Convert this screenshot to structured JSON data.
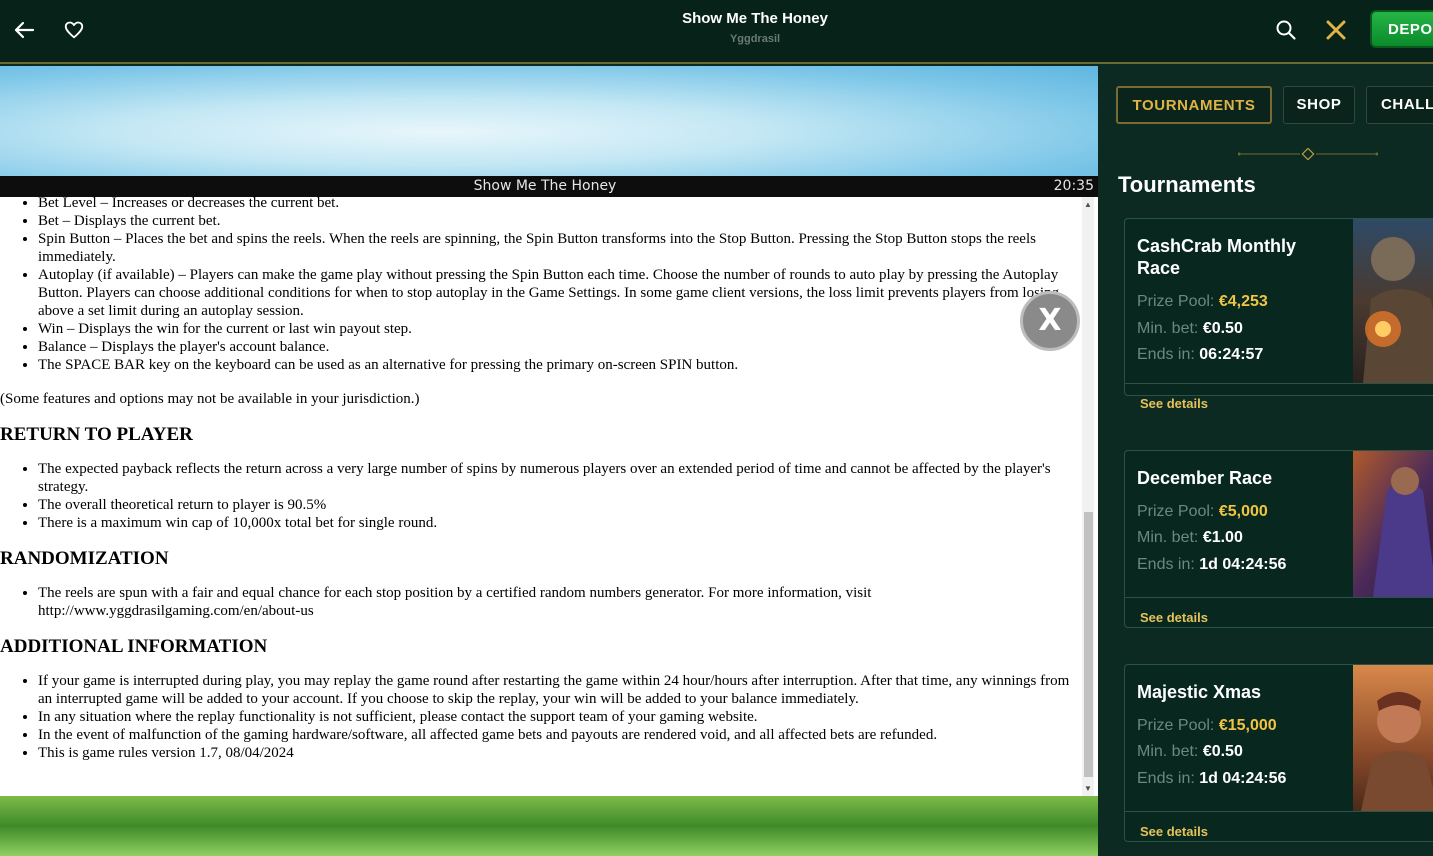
{
  "header": {
    "title": "Show Me The Honey",
    "subtitle": "Yggdrasil",
    "deposit_label": "DEPO"
  },
  "game": {
    "title": "Show Me The Honey",
    "time": "20:35",
    "close_label": "X"
  },
  "rules": {
    "list1": [
      "Bet Level – Increases or decreases the current bet.",
      "Bet – Displays the current bet.",
      "Spin Button – Places the bet and spins the reels. When the reels are spinning, the Spin Button transforms into the Stop Button. Pressing the Stop Button stops the reels immediately.",
      "Autoplay (if available) – Players can make the game play without pressing the Spin Button each time. Choose the number of rounds to auto play by pressing the Autoplay Button. Players can choose additional conditions for when to stop autoplay in the Game Settings. In some game client versions, the loss limit prevents players from losing above a set limit during an autoplay session.",
      "Win – Displays the win for the current or last win payout step.",
      "Balance – Displays the player's account balance.",
      "The SPACE BAR key on the keyboard can be used as an alternative for pressing the primary on-screen SPIN button."
    ],
    "note": "(Some features and options may not be available in your jurisdiction.)",
    "h_rtp": "RETURN TO PLAYER",
    "list_rtp": [
      "The expected payback reflects the return across a very large number of spins by numerous players over an extended period of time and cannot be affected by the player's strategy.",
      "The overall theoretical return to player is 90.5%",
      "There is a maximum win cap of 10,000x total bet for single round."
    ],
    "h_rand": "RANDOMIZATION",
    "list_rand": [
      "The reels are spun with a fair and equal chance for each stop position by a certified random numbers generator. For more information, visit http://www.yggdrasilgaming.com/en/about-us"
    ],
    "h_add": "ADDITIONAL INFORMATION",
    "list_add": [
      "If your game is interrupted during play, you may replay the game round after restarting the game within 24 hour/hours after interruption. After that time, any winnings from an interrupted game will be added to your account. If you choose to skip the replay, your win will be added to your balance immediately.",
      "In any situation where the replay functionality is not sufficient, please contact the support team of your gaming website.",
      "In the event of malfunction of the gaming hardware/software, all affected game bets and payouts are rendered void, and all affected bets are refunded.",
      "This is game rules version 1.7, 08/04/2024"
    ]
  },
  "side": {
    "tabs": [
      "TOURNAMENTS",
      "SHOP",
      "CHALL"
    ],
    "title": "Tournaments",
    "prize_label": "Prize Pool:",
    "minbet_label": "Min. bet:",
    "ends_label": "Ends in:",
    "details_label": "See details",
    "cards": [
      {
        "name": "CashCrab Monthly Race",
        "prize": "€4,253",
        "min_bet": "€0.50",
        "ends": "06:24:57"
      },
      {
        "name": "December Race",
        "prize": "€5,000",
        "min_bet": "€1.00",
        "ends": "1d 04:24:56"
      },
      {
        "name": "Majestic Xmas",
        "prize": "€15,000",
        "min_bet": "€0.50",
        "ends": "1d 04:24:56"
      }
    ]
  },
  "colors": {
    "accent_gold": "#e0b345",
    "prize_gold": "#f1c443",
    "deposit_green": "#1fa63c",
    "panel_bg": "#0c2a22"
  },
  "icons": [
    "back-arrow-icon",
    "heart-icon",
    "search-icon",
    "close-icon"
  ]
}
